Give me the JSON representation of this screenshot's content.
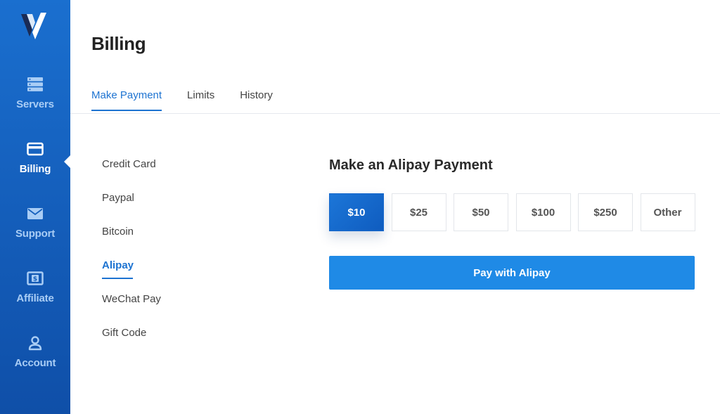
{
  "sidebar": {
    "logo_icon": "vultr-v-logo-icon",
    "items": [
      {
        "label": "Servers",
        "icon": "server-stack-icon",
        "active": false
      },
      {
        "label": "Billing",
        "icon": "credit-card-icon",
        "active": true
      },
      {
        "label": "Support",
        "icon": "envelope-icon",
        "active": false
      },
      {
        "label": "Affiliate",
        "icon": "dollar-bill-icon",
        "active": false
      },
      {
        "label": "Account",
        "icon": "user-icon",
        "active": false
      }
    ]
  },
  "page": {
    "title": "Billing"
  },
  "tabs": [
    {
      "label": "Make Payment",
      "active": true
    },
    {
      "label": "Limits",
      "active": false
    },
    {
      "label": "History",
      "active": false
    }
  ],
  "methods": [
    {
      "label": "Credit Card",
      "active": false
    },
    {
      "label": "Paypal",
      "active": false
    },
    {
      "label": "Bitcoin",
      "active": false
    },
    {
      "label": "Alipay",
      "active": true
    },
    {
      "label": "WeChat Pay",
      "active": false
    },
    {
      "label": "Gift Code",
      "active": false
    }
  ],
  "panel": {
    "title": "Make an Alipay Payment",
    "amounts": [
      {
        "label": "$10",
        "selected": true
      },
      {
        "label": "$25",
        "selected": false
      },
      {
        "label": "$50",
        "selected": false
      },
      {
        "label": "$100",
        "selected": false
      },
      {
        "label": "$250",
        "selected": false
      },
      {
        "label": "Other",
        "selected": false
      }
    ],
    "pay_button_label": "Pay with Alipay"
  },
  "colors": {
    "accent": "#1d73d1",
    "sidebar": "#1560bd",
    "pay_button": "#1f8ae6"
  }
}
